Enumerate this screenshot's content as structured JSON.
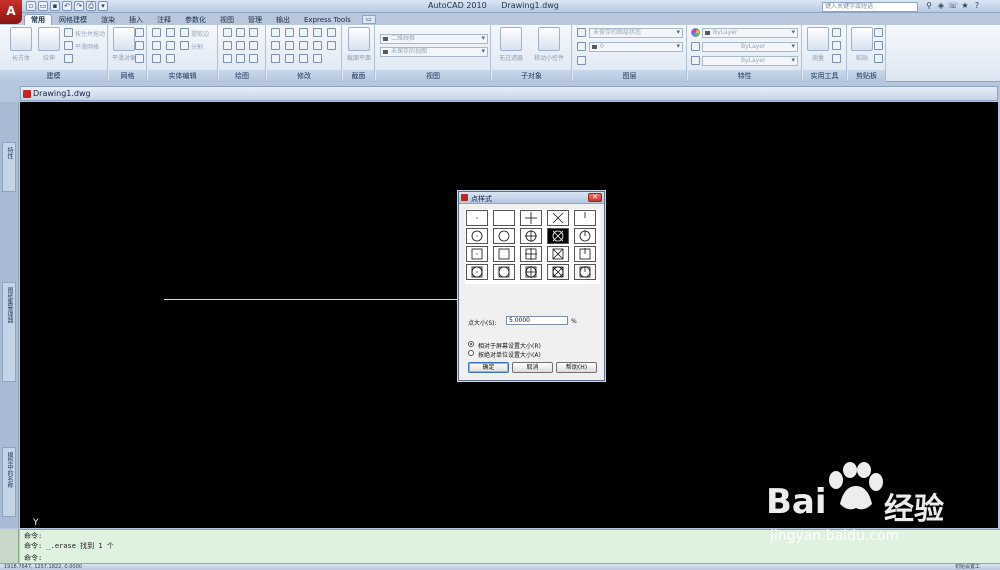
{
  "title_bar": {
    "app_name": "AutoCAD 2010",
    "file_name": "Drawing1.dwg",
    "search_placeholder": "键入关键字或短语",
    "app_logo": "A"
  },
  "ribbon_tabs": [
    "常用",
    "网格建模",
    "渲染",
    "插入",
    "注释",
    "参数化",
    "视图",
    "管理",
    "输出",
    "Express Tools"
  ],
  "ribbon_panels": {
    "modeling": {
      "label": "建模",
      "items": [
        "长方体",
        "拉伸",
        "按住并拖动",
        "平滑网格"
      ]
    },
    "mesh": {
      "label": "网格",
      "items": [
        "平滑对象"
      ]
    },
    "solid_edit": {
      "label": "实体编辑",
      "items": [
        "提取边",
        "分割"
      ]
    },
    "draw": {
      "label": "绘图"
    },
    "modify": {
      "label": "修改"
    },
    "section": {
      "label": "截面",
      "items": [
        "截面平面"
      ]
    },
    "view": {
      "label": "视图",
      "combo1": "二维线框",
      "combo2": "未保存的视图"
    },
    "subobject": {
      "label": "子对象",
      "items": [
        "无过滤器",
        "移动小控件"
      ]
    },
    "layers": {
      "label": "图层",
      "combo1": "未保存的图层状态",
      "combo2": "0"
    },
    "properties": {
      "label": "特性",
      "color": "ByLayer",
      "linetype": "ByLayer",
      "lineweight": "ByLayer"
    },
    "utilities": {
      "label": "实用工具",
      "items": [
        "测量"
      ]
    },
    "clipboard": {
      "label": "剪贴板",
      "items": [
        "粘贴"
      ]
    }
  },
  "document_tab": "Drawing1.dwg",
  "side_palettes": [
    "特性",
    "图纸集管理器",
    "模型中的名称"
  ],
  "ucs_icon": "Y",
  "command_lines": [
    "命令:",
    "命令: _.erase 找到 1 个",
    "命令:"
  ],
  "status_bar": {
    "coords": "1918.7647, 1257.1822, 0.0000",
    "right_label": "初始设置工"
  },
  "dialog": {
    "title": "点样式",
    "close_glyph": "✕",
    "point_size_label": "点大小(S):",
    "point_size_value": "5.0000",
    "unit": "%",
    "radio_relative": "相对于屏幕设置大小(R)",
    "radio_absolute": "按绝对单位设置大小(A)",
    "ok": "确定",
    "cancel": "取消",
    "help": "帮助(H)",
    "selected_style_index": 8,
    "styles": [
      "dot",
      "blank",
      "plus",
      "cross",
      "tick",
      "dot-circle",
      "blank-circle",
      "plus-circle",
      "cross-circle",
      "tick-circle",
      "dot-square",
      "blank-square",
      "plus-square",
      "cross-square",
      "tick-square",
      "dot-circle-square",
      "blank-circle-square",
      "plus-circle-square",
      "cross-circle-square",
      "tick-circle-square"
    ]
  },
  "watermark": {
    "logo": "Bai",
    "logo_cn": "经验",
    "url": "jingyan.baidu.com"
  },
  "colors": {
    "canvas": "#000000",
    "command_bg": "#dff1df",
    "ribbon": "#dce6f2",
    "selected_cell": "#000000"
  }
}
